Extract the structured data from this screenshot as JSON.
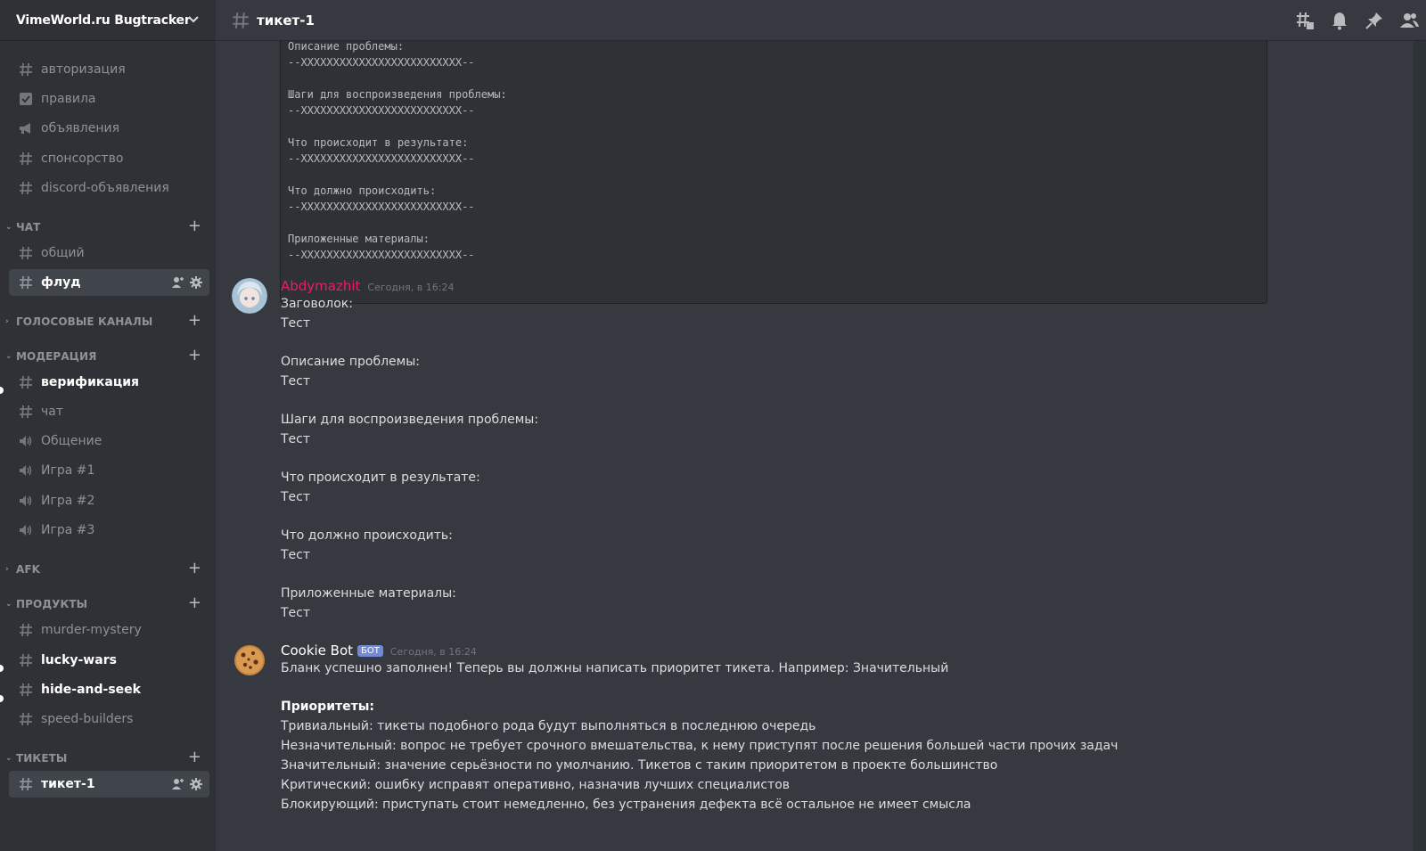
{
  "server": {
    "name": "VimeWorld.ru Bugtracker"
  },
  "channel": {
    "title": "тикет-1"
  },
  "sidebar": {
    "top_channels": [
      {
        "label": "авторизация",
        "icon": "hash-icon"
      },
      {
        "label": "правила",
        "icon": "checkbox-icon"
      },
      {
        "label": "объявления",
        "icon": "megaphone-icon"
      },
      {
        "label": "спонсорство",
        "icon": "hash-icon"
      },
      {
        "label": "discord-объявления",
        "icon": "hash-icon"
      }
    ],
    "categories": {
      "chat": {
        "label": "ЧАТ",
        "channels": [
          "общий",
          "флуд"
        ]
      },
      "voice": {
        "label": "ГОЛОСОВЫЕ КАНАЛЫ"
      },
      "moderation": {
        "label": "МОДЕРАЦИЯ",
        "channels": [
          "верификация",
          "чат",
          "Общение",
          "Игра #1",
          "Игра #2",
          "Игра #3"
        ]
      },
      "afk": {
        "label": "AFK"
      },
      "products": {
        "label": "ПРОДУКТЫ",
        "channels": [
          "murder-mystery",
          "lucky-wars",
          "hide-and-seek",
          "speed-builders"
        ]
      },
      "tickets": {
        "label": "ТИКЕТЫ",
        "channels": [
          "тикет-1"
        ]
      }
    }
  },
  "codeblock": {
    "text": "Описание проблемы:\n--XXXXXXXXXXXXXXXXXXXXXXXXX--\n\nШаги для воспроизведения проблемы:\n--XXXXXXXXXXXXXXXXXXXXXXXXX--\n\nЧто происходит в результате:\n--XXXXXXXXXXXXXXXXXXXXXXXXX--\n\nЧто должно происходить:\n--XXXXXXXXXXXXXXXXXXXXXXXXX--\n\nПриложенные материалы:\n--XXXXXXXXXXXXXXXXXXXXXXXXX--"
  },
  "messages": [
    {
      "author": "Abdymazhit",
      "author_color": "#e91e63",
      "timestamp": "Сегодня, в 16:24",
      "lines": [
        "Заговолок:",
        "Тест",
        "Описание проблемы:",
        "Тест",
        "Шаги для воспроизведения проблемы:",
        "Тест",
        "Что происходит в результате:",
        "Тест",
        "Что должно происходить:",
        "Тест",
        "Приложенные материалы:",
        "Тест"
      ]
    },
    {
      "author": "Cookie Bot",
      "author_color": "#ffffff",
      "bot_tag": "БОТ",
      "timestamp": "Сегодня, в 16:24",
      "lines": [
        "Бланк успешно заполнен! Теперь вы должны написать приоритет тикета. Например: Значительный",
        "Приоритеты:",
        "Тривиальный: тикеты подобного рода будут выполняться в последнюю очередь",
        "Незначительный: вопрос не требует срочного вмешательства, к нему приступят после решения большей части прочих задач",
        "Значительный: значение серьёзности по умолчанию. Тикетов с таким приоритетом в проекте большинство",
        "Критический: ошибку исправят оперативно, назначив лучших специалистов",
        "Блокирующий: приступать стоит немедленно, без устранения дефекта всё остальное не имеет смысла"
      ]
    }
  ],
  "colors": {
    "background": "#36393f",
    "sidebar": "#2f3136",
    "accent": "#7289da"
  }
}
